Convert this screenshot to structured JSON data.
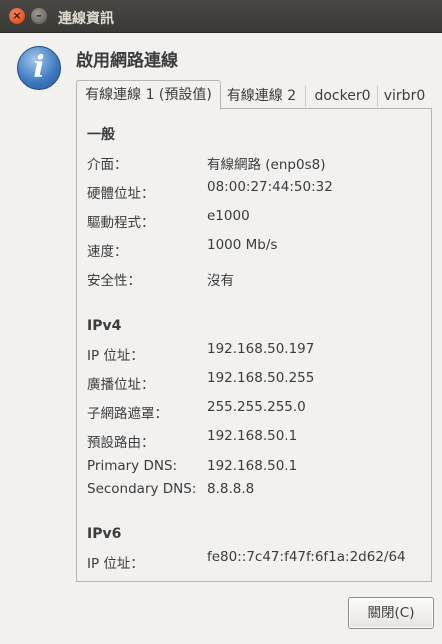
{
  "window": {
    "title": "連線資訊",
    "close_glyph": "×",
    "minimize_glyph": "–"
  },
  "icon": {
    "name": "info-icon",
    "glyph": "i"
  },
  "heading": "啟用網路連線",
  "tabs": [
    "有線連線 1 (預設值)",
    "有線連線 2",
    "docker0",
    "virbr0"
  ],
  "general": {
    "title": "一般",
    "rows": [
      {
        "label": "介面：",
        "value": "有線網路 (enp0s8)"
      },
      {
        "label": "硬體位址：",
        "value": "08:00:27:44:50:32"
      },
      {
        "label": "驅動程式：",
        "value": "e1000"
      },
      {
        "label": "速度：",
        "value": "1000 Mb/s"
      },
      {
        "label": "安全性：",
        "value": "沒有"
      }
    ]
  },
  "ipv4": {
    "title": "IPv4",
    "rows": [
      {
        "label": "IP 位址：",
        "value": "192.168.50.197"
      },
      {
        "label": "廣播位址：",
        "value": "192.168.50.255"
      },
      {
        "label": "子網路遮罩：",
        "value": "255.255.255.0"
      },
      {
        "label": "預設路由：",
        "value": "192.168.50.1"
      },
      {
        "label": "Primary DNS:",
        "value": "192.168.50.1"
      },
      {
        "label": "Secondary DNS:",
        "value": "8.8.8.8"
      }
    ]
  },
  "ipv6": {
    "title": "IPv6",
    "rows": [
      {
        "label": "IP 位址：",
        "value": "fe80::7c47:f47f:6f1a:2d62/64"
      }
    ]
  },
  "close_button": "關閉(C)"
}
